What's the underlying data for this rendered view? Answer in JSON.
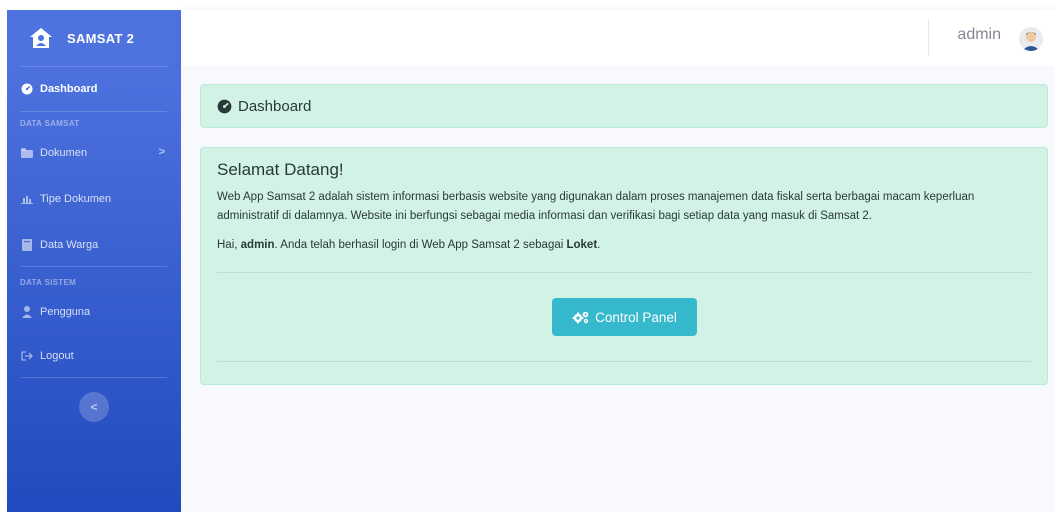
{
  "sidebar": {
    "brand": "SAMSAT 2",
    "dashboard": "Dashboard",
    "heading_data_samsat": "DATA SAMSAT",
    "dokumen": "Dokumen",
    "dokumen_chevron": ">",
    "tipe_dokumen": "Tipe Dokumen",
    "data_warga": "Data Warga",
    "heading_data_sistem": "DATA SISTEM",
    "pengguna": "Pengguna",
    "logout": "Logout",
    "toggle": "<"
  },
  "topbar": {
    "username": "admin"
  },
  "breadcrumb": {
    "title": "Dashboard"
  },
  "welcome": {
    "title": "Selamat Datang!",
    "description": "Web App Samsat 2 adalah sistem informasi berbasis website yang digunakan dalam proses manajemen data fiskal serta berbagai macam keperluan administratif di dalamnya. Website ini berfungsi sebagai media informasi dan verifikasi bagi setiap data yang masuk di Samsat 2.",
    "greeting_prefix": "Hai, ",
    "greeting_user": "admin",
    "greeting_middle": ". Anda telah berhasil login di Web App Samsat 2 sebagai ",
    "greeting_role": "Loket",
    "greeting_suffix": ".",
    "button_label": "Control Panel"
  },
  "colors": {
    "sidebar_top": "#4e73df",
    "sidebar_bottom": "#224abe",
    "card_bg": "#d1f2e5",
    "button": "#36b9cc"
  },
  "icons": {
    "brand": "house-user-icon",
    "dashboard": "tachometer-icon",
    "dokumen": "folder-icon",
    "tipe_dokumen": "chart-icon",
    "data_warga": "book-icon",
    "pengguna": "user-icon",
    "logout": "sign-out-icon",
    "control_panel": "cogs-icon"
  }
}
